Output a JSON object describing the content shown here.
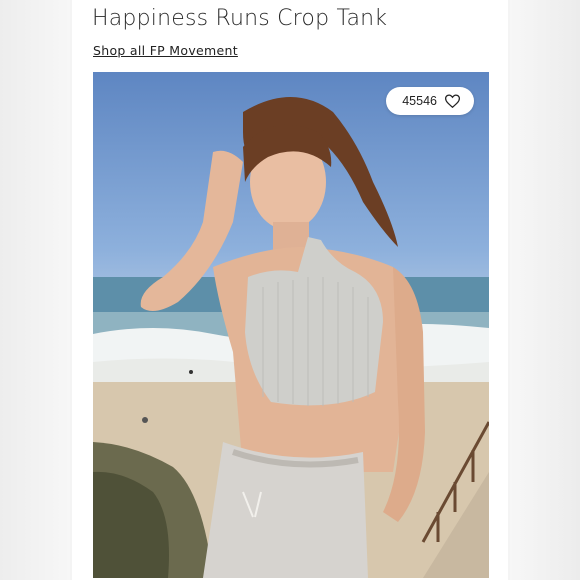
{
  "product": {
    "title": "Happiness Runs Crop Tank",
    "shop_link": "Shop all FP Movement"
  },
  "photo": {
    "likes": "45546",
    "like_icon": "heart-icon"
  },
  "colors": {
    "background": "#ffffff",
    "text": "#2a2a2a"
  }
}
